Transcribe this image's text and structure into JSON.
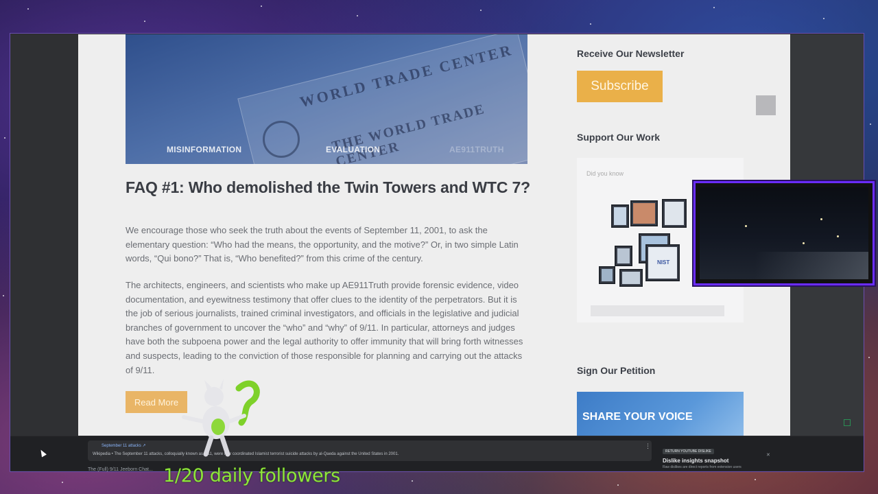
{
  "hero": {
    "tags": [
      "MISINFORMATION",
      "EVALUATION",
      "AE911TRUTH"
    ],
    "image_text_1": "WORLD TRADE CENTER",
    "image_text_2": "THE WORLD TRADE CENTER"
  },
  "article": {
    "title": "FAQ #1: Who demolished the Twin Towers and WTC 7?",
    "paragraph_1": "We encourage those who seek the truth about the events of September 11, 2001, to ask the elementary question: “Who had the means, the opportunity, and the motive?” Or, in two simple Latin words, “Qui bono?” That is, “Who benefited?” from this crime of the century.",
    "paragraph_2": "The architects, engineers, and scientists who make up AE911Truth provide forensic evidence, video documentation, and eyewitness testimony that offer clues to the identity of the perpetrators. But it is the job of serious journalists, trained criminal investigators, and officials in the legislative and judicial branches of government to uncover the “who” and “why” of 9/11. In particular, attorneys and judges have both the subpoena power and the legal authority to offer immunity that will bring forth witnesses and suspects, leading to the conviction of those responsible for planning and carrying out the attacks of 9/11.",
    "read_more_label": "Read More"
  },
  "sidebar": {
    "newsletter_heading": "Receive Our Newsletter",
    "subscribe_label": "Subscribe",
    "support_heading": "Support Our Work",
    "support_hint": "Did you know",
    "device_label": "NIST",
    "petition_heading": "Sign Our Petition",
    "petition_text": "SHARE YOUR VOICE"
  },
  "bottom_panel": {
    "wiki_link": "September 11 attacks ↗",
    "wiki_desc": "Wikipedia • The September 11 attacks, colloquially known as 9/11, were four coordinated Islamist terrorist suicide attacks by al-Qaeda against the United States in 2001.",
    "wiki_footer": "The (Full) 9/11 Jeeborn Chat...",
    "menu_glyph": "⋮",
    "dislike_badge": "RETURN YOUTUBE DISLIKE",
    "dislike_title": "Dislike insights snapshot",
    "dislike_sub": "Raw dislikes are direct reports from extension users",
    "dislike_close": "✕"
  },
  "overlay": {
    "followers_text": "1/20 daily followers"
  }
}
